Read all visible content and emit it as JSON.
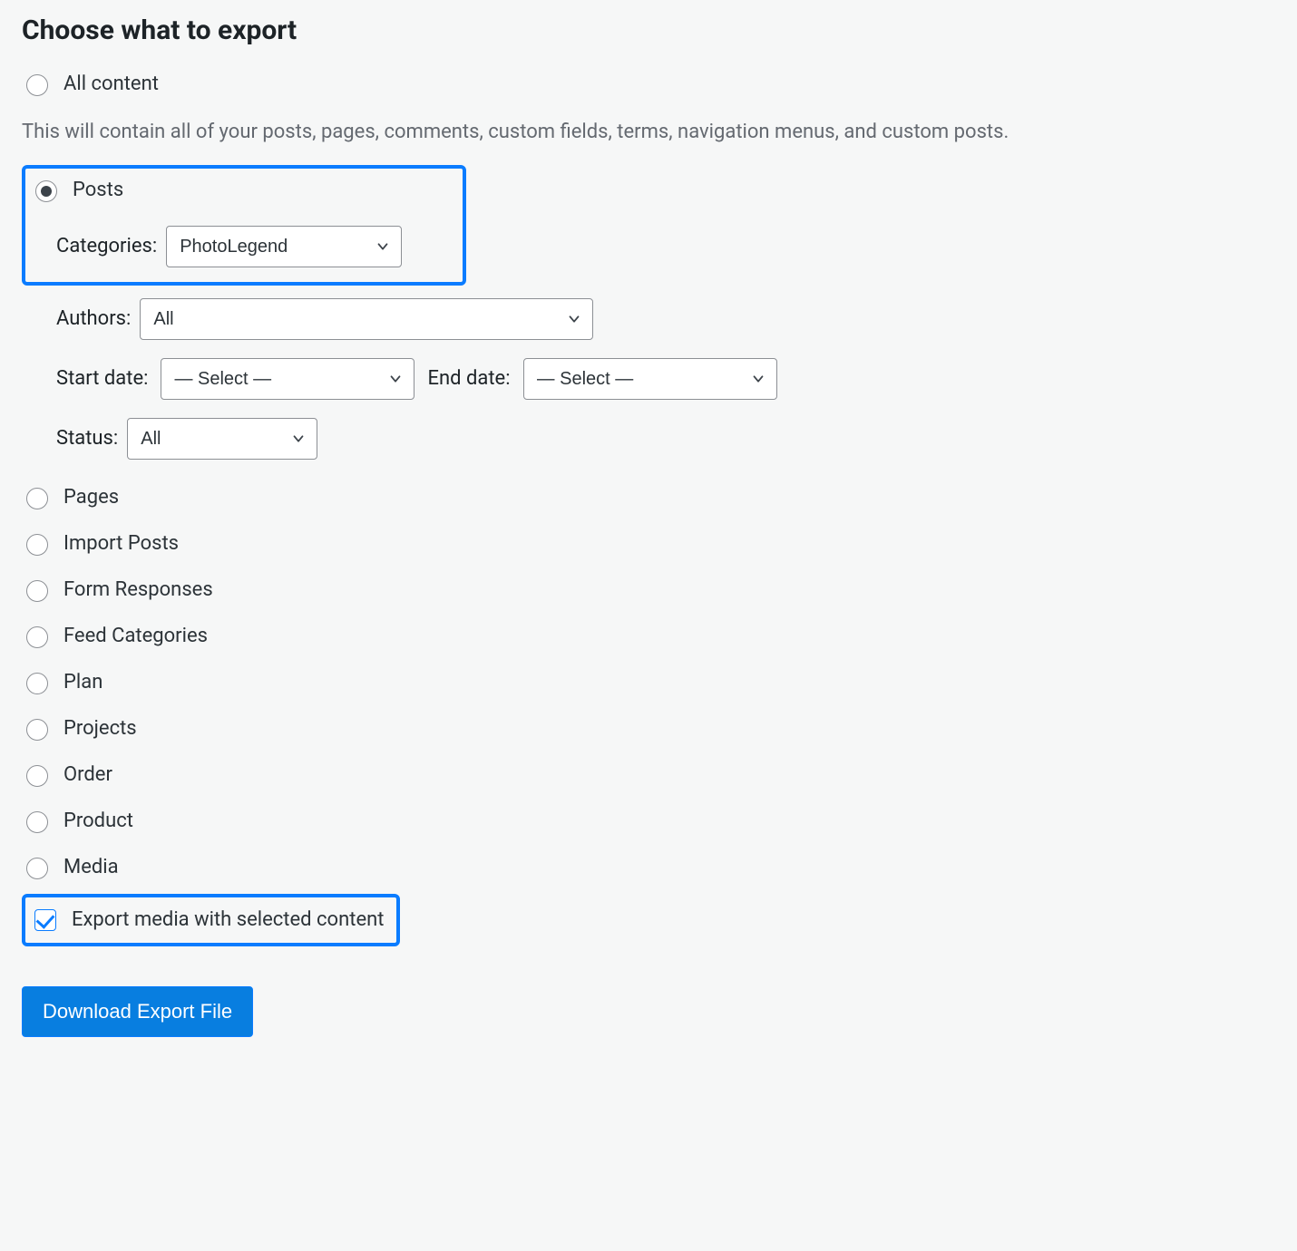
{
  "heading": "Choose what to export",
  "options": {
    "all_content": "All content",
    "all_content_desc": "This will contain all of your posts, pages, comments, custom fields, terms, navigation menus, and custom posts.",
    "posts": "Posts",
    "pages": "Pages",
    "import_posts": "Import Posts",
    "form_responses": "Form Responses",
    "feed_categories": "Feed Categories",
    "plan": "Plan",
    "projects": "Projects",
    "order": "Order",
    "product": "Product",
    "media": "Media"
  },
  "filters": {
    "categories_label": "Categories:",
    "categories_value": "PhotoLegend",
    "authors_label": "Authors:",
    "authors_value": "All",
    "start_date_label": "Start date:",
    "start_date_value": "— Select —",
    "end_date_label": "End date:",
    "end_date_value": "— Select —",
    "status_label": "Status:",
    "status_value": "All"
  },
  "export_media_label": "Export media with selected content",
  "download_button_label": "Download Export File"
}
